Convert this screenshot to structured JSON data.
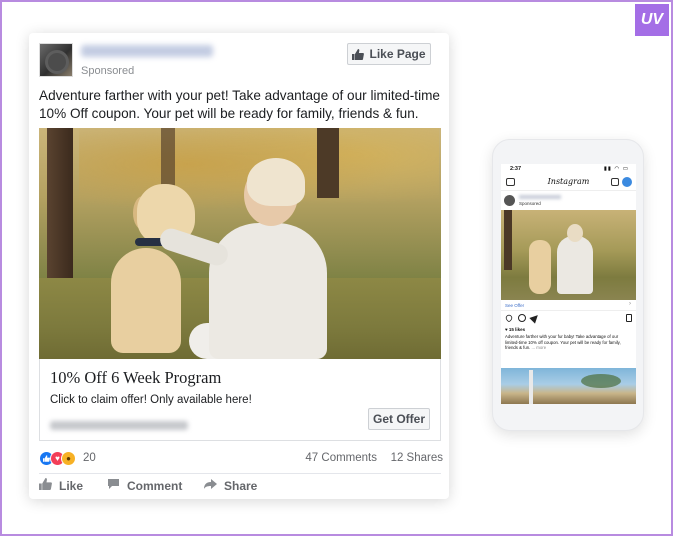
{
  "brand_badge": "UV",
  "facebook_post": {
    "sponsored_label": "Sponsored",
    "like_page_label": "Like Page",
    "post_text": "Adventure farther with your pet! Take advantage of our limited-time 10% Off coupon. Your pet will be ready for family, friends & fun.",
    "ad_title": "10% Off 6 Week Program",
    "ad_description": "Click to claim offer! Only available here!",
    "cta_label": "Get Offer",
    "reaction_count": "20",
    "comments_count": "47 Comments",
    "shares_count": "12 Shares",
    "actions": {
      "like": "Like",
      "comment": "Comment",
      "share": "Share"
    },
    "colors": {
      "like_blue": "#1877f2",
      "love_red": "#f33e58",
      "wow_yellow": "#f7b125"
    }
  },
  "instagram_preview": {
    "status_time": "2:37",
    "logo_text": "Instagram",
    "sponsored_label": "Sponsored",
    "see_offer_label": "See Offer",
    "likes_text": "♥ 15 likes",
    "caption": "Adventure farther with your fur baby! Take advantage of our limited-time 10% off coupon. Your pet will be ready for family, friends & fun.",
    "caption_more": "... more"
  },
  "icons": [
    "thumbs-up-icon",
    "comment-icon",
    "share-icon",
    "camera-icon",
    "igtv-icon",
    "direct-message-icon",
    "heart-icon",
    "send-icon",
    "bookmark-icon"
  ]
}
